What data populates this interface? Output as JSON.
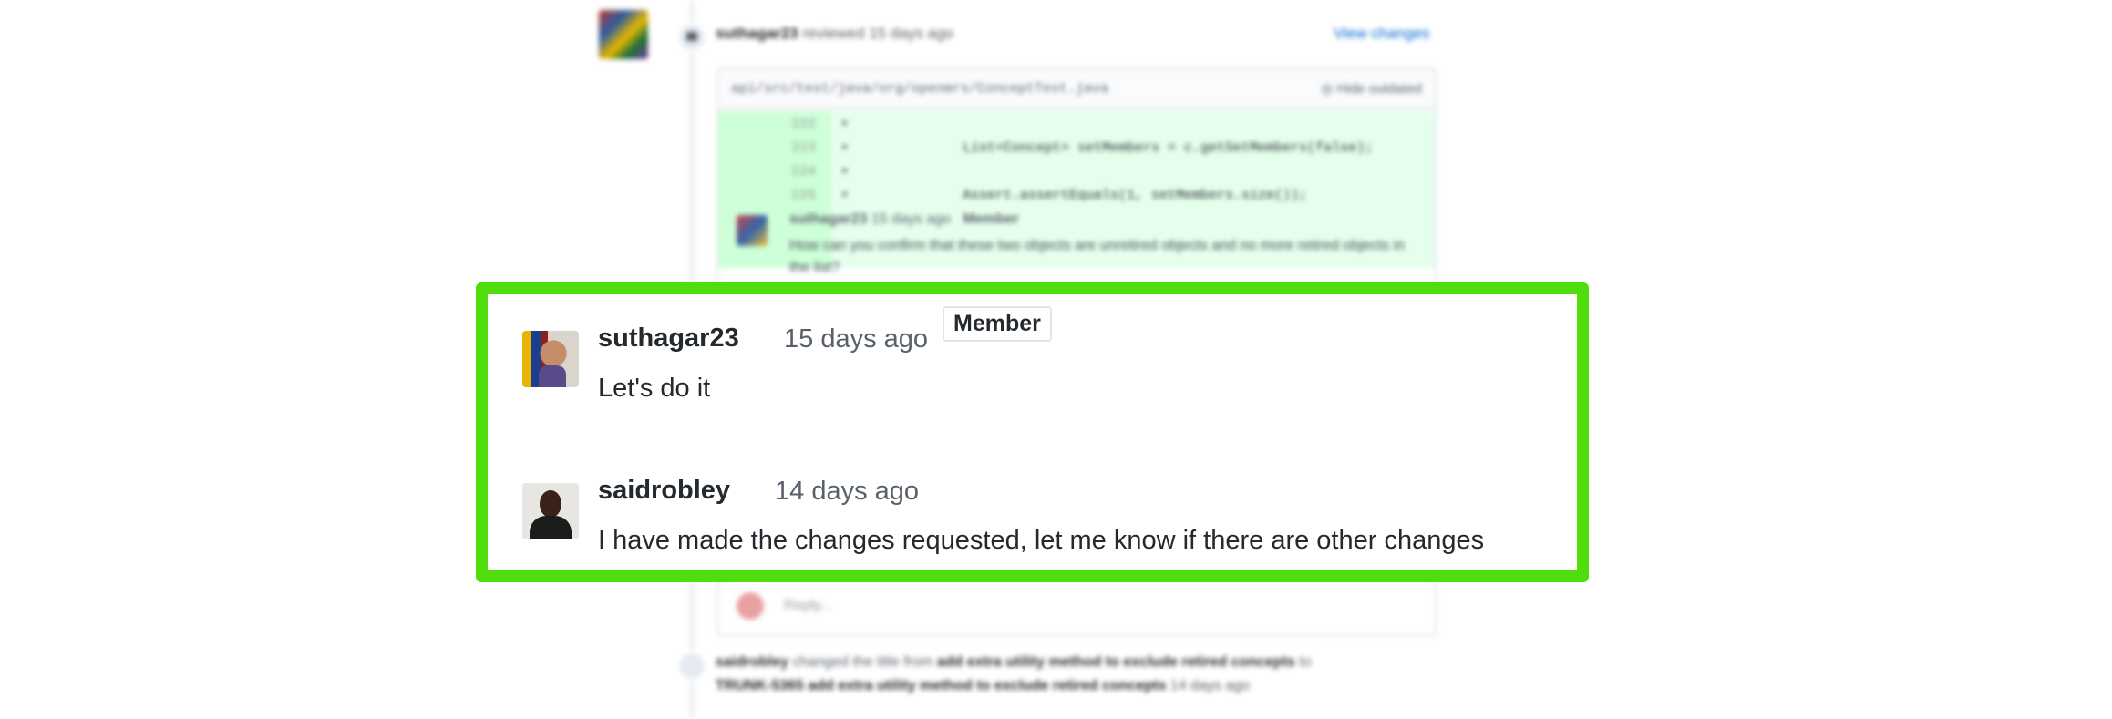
{
  "background": {
    "review": {
      "user": "suthagar23",
      "action": "reviewed",
      "time": "15 days ago",
      "view_changes_label": "View changes"
    },
    "file": {
      "path": "api/src/test/java/org/openmrs/ConceptTest.java",
      "hide_outdated_label": "Hide outdated"
    },
    "diff_lines": [
      {
        "ln": "222",
        "code": ""
      },
      {
        "ln": "223",
        "code": "List<Concept> setMembers = c.getSetMembers(false);"
      },
      {
        "ln": "224",
        "code": ""
      },
      {
        "ln": "225",
        "code": "Assert.assertEquals(1, setMembers.size());"
      }
    ],
    "inline_comment": {
      "user": "suthagar23",
      "time": "15 days ago",
      "badge": "Member",
      "body": "How can you confirm that these two objects are unretired objects and no more retired objects in the list?"
    },
    "reply_placeholder": "Reply...",
    "event": {
      "user": "saidrobley",
      "text": "changed the title from",
      "old_title": "add extra utility method to exclude retired concepts",
      "to": "to",
      "new_title": "TRUNK-5365 add extra utility method to exclude retired concepts",
      "time": "14 days ago"
    }
  },
  "highlight": {
    "border_color": "#4fdd0b",
    "comments": [
      {
        "author": "suthagar23",
        "time": "15 days ago",
        "badge": "Member",
        "body": "Let's do it"
      },
      {
        "author": "saidrobley",
        "time": "14 days ago",
        "body": "I have made the changes requested, let me know if there are other changes"
      }
    ]
  }
}
